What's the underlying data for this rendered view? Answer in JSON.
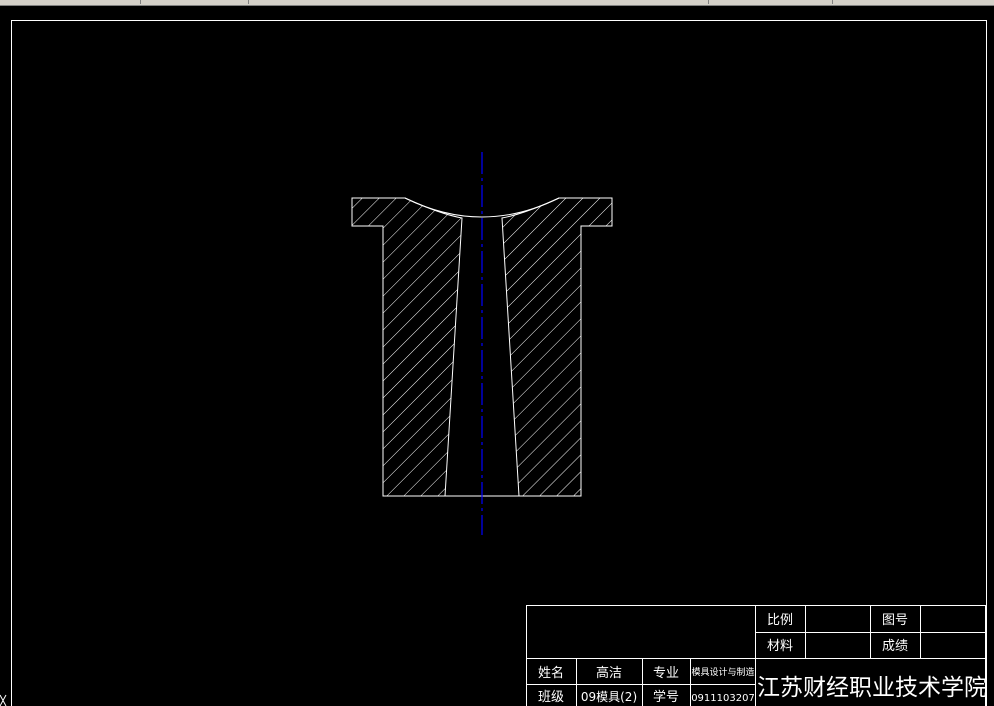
{
  "colors": {
    "background": "#000000",
    "lines": "#ffffff",
    "centerline": "#0000ff"
  },
  "title_block": {
    "scale_label": "比例",
    "drawing_no_label": "图号",
    "material_label": "材料",
    "grade_label": "成绩",
    "name_label": "姓名",
    "name_value": "高洁",
    "major_label": "专业",
    "major_value": "模具设计与制造",
    "class_label": "班级",
    "class_value": "09模具(2)",
    "student_id_label": "学号",
    "student_id_value": "0911103207",
    "school": "江苏财经职业技术学院"
  }
}
